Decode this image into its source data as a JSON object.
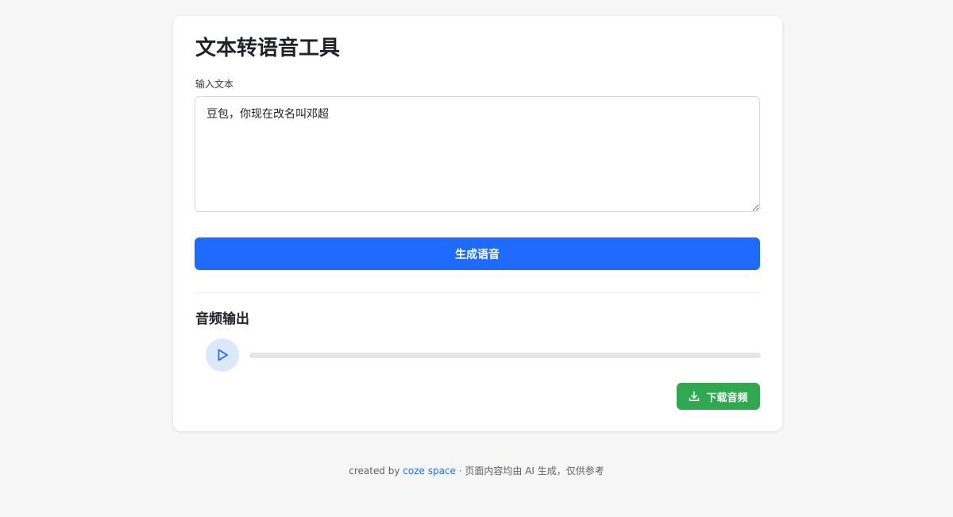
{
  "app": {
    "title": "文本转语音工具"
  },
  "input": {
    "label": "输入文本",
    "value": "豆包，你现在改名叫邓超"
  },
  "actions": {
    "generate_label": "生成语音"
  },
  "audio": {
    "section_title": "音频输出",
    "play_icon": "play-icon",
    "progress_percent": 0,
    "download_label": "下载音频",
    "download_icon": "download-icon"
  },
  "footer": {
    "prefix": "created by ",
    "link_text": "coze space",
    "suffix": " · 页面内容均由 AI 生成，仅供参考"
  },
  "colors": {
    "primary": "#1f6bff",
    "success": "#2fa84f",
    "play_bg": "#dce8fb"
  }
}
